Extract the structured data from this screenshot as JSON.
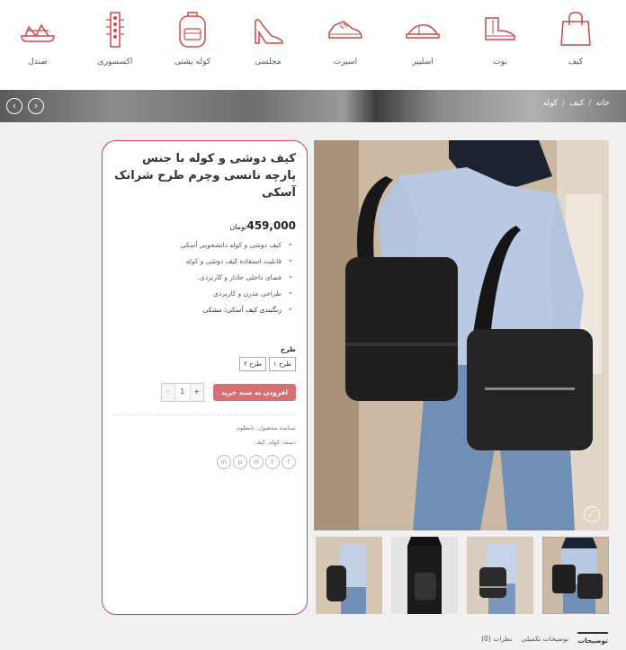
{
  "categories": [
    {
      "label": "کیف",
      "icon": "handbag-icon"
    },
    {
      "label": "بوت",
      "icon": "boot-icon"
    },
    {
      "label": "اسلیپر",
      "icon": "slipper-icon"
    },
    {
      "label": "اسپرت",
      "icon": "sneaker-icon"
    },
    {
      "label": "مجلسی",
      "icon": "high-heel-icon"
    },
    {
      "label": "کوله پشتی",
      "icon": "backpack-icon"
    },
    {
      "label": "اکسسوری",
      "icon": "accessory-icon"
    },
    {
      "label": "صندل",
      "icon": "sandal-icon"
    }
  ],
  "breadcrumb": [
    "خانه",
    "کیف",
    "کوله"
  ],
  "product": {
    "title": "کیف دوشی و کوله با جنس پارچه نانسی وچرم طرح شرانک آسکی",
    "price": "459,000",
    "currency": "تومان",
    "features": [
      "کیف دوشی و کوله دانشجویی آسکی",
      "قابلیت استفاده کیف دوشی و کوله",
      "فضای داخلی جادار و کاربردی.",
      "طراحی مدرن و کاربردی",
      "رنگبندی کیف آسکی: مشکی"
    ],
    "variant_label": "طرح",
    "variants": [
      "طرح ۱",
      "طرح ۲"
    ],
    "quantity": "1",
    "qty_minus": "-",
    "qty_plus": "+",
    "add_to_cart": "افزودن به سبد خرید",
    "sku": "شناسه محصول: نامعلوم",
    "category": "دسته: کوله, کیف"
  },
  "share_icons": [
    "facebook-icon",
    "twitter-icon",
    "email-icon",
    "pinterest-icon",
    "linkedin-icon"
  ],
  "tabs": [
    "توضیحات",
    "توضیحات تکمیلی",
    "نظرات (0)"
  ],
  "colors": {
    "accent": "#c9494b",
    "button": "#d86f71"
  }
}
